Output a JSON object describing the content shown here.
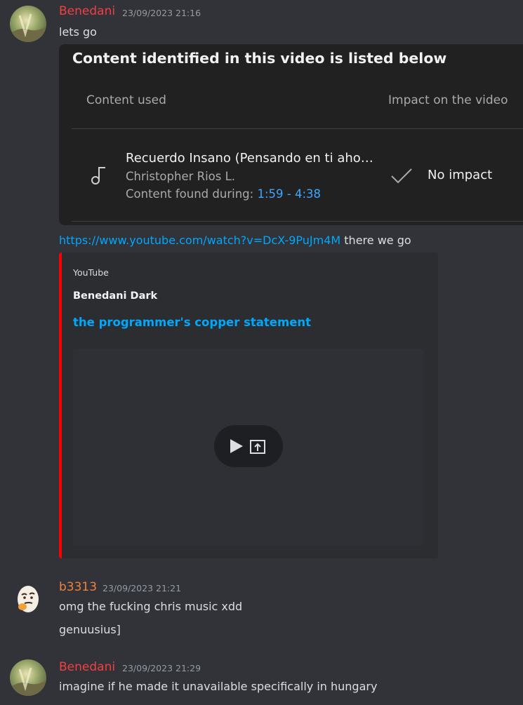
{
  "messages": [
    {
      "author": "Benedani",
      "author_color": "#f23f42",
      "timestamp": "23/09/2023 21:16",
      "text": "lets go"
    },
    {
      "link": "https://www.youtube.com/watch?v=DcX-9PuJm4M",
      "text_after": " there we go"
    },
    {
      "author": "b3313",
      "author_color": "#f0813a",
      "timestamp": "23/09/2023 21:21",
      "text": "omg the fucking chris music xdd",
      "text2": "genuusius]"
    },
    {
      "author": "Benedani",
      "author_color": "#f23f42",
      "timestamp": "23/09/2023 21:29",
      "text": "imagine if he made it unavailable specifically in hungary"
    }
  ],
  "attachment": {
    "heading": "Content identified in this video is listed below",
    "col_content": "Content used",
    "col_impact": "Impact on the video",
    "song": "Recuerdo Insano (Pensando en ti aho…",
    "artist": "Christopher Rios L.",
    "found_label": "Content found during: ",
    "found_time": "1:59 - 4:38",
    "impact": "No impact",
    "music_icon": "music-note-icon",
    "check_icon": "checkmark-icon"
  },
  "embed": {
    "provider": "YouTube",
    "author": "Benedani Dark",
    "title": "the programmer's copper statement",
    "accent_color": "#ff0000",
    "play_icon": "play-icon",
    "popout_icon": "open-external-icon"
  },
  "colors": {
    "background": "#313338",
    "link": "#00a8fc",
    "timestamp": "#949ba4"
  }
}
